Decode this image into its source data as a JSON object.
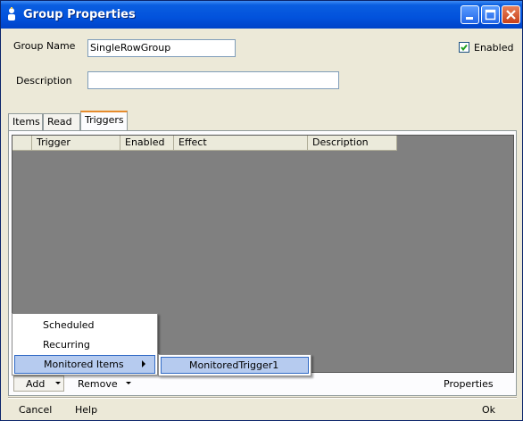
{
  "window": {
    "title": "Group Properties"
  },
  "form": {
    "group_name_label": "Group Name",
    "group_name_value": "SingleRowGroup",
    "enabled_label": "Enabled",
    "enabled_checked": true,
    "description_label": "Description",
    "description_value": ""
  },
  "tabs": [
    {
      "label": "Items",
      "active": false
    },
    {
      "label": "Read",
      "active": false
    },
    {
      "label": "Triggers",
      "active": true
    }
  ],
  "grid": {
    "columns": [
      "Trigger",
      "Enabled",
      "Effect",
      "Description"
    ],
    "rows": []
  },
  "toolbar": {
    "add_label": "Add",
    "remove_label": "Remove",
    "properties_label": "Properties"
  },
  "add_menu": {
    "items": [
      {
        "label": "Scheduled"
      },
      {
        "label": "Recurring"
      },
      {
        "label": "Monitored Items",
        "has_submenu": true,
        "highlighted": true
      }
    ],
    "submenu": [
      {
        "label": "MonitoredTrigger1",
        "highlighted": true
      }
    ]
  },
  "footer": {
    "cancel_label": "Cancel",
    "help_label": "Help",
    "ok_label": "Ok"
  },
  "colors": {
    "title_bar": "#0a5ee0",
    "window_bg": "#ece9d8",
    "grid_bg": "#808080",
    "menu_highlight": "#b6cbef",
    "active_tab_accent": "#e68b2c"
  }
}
